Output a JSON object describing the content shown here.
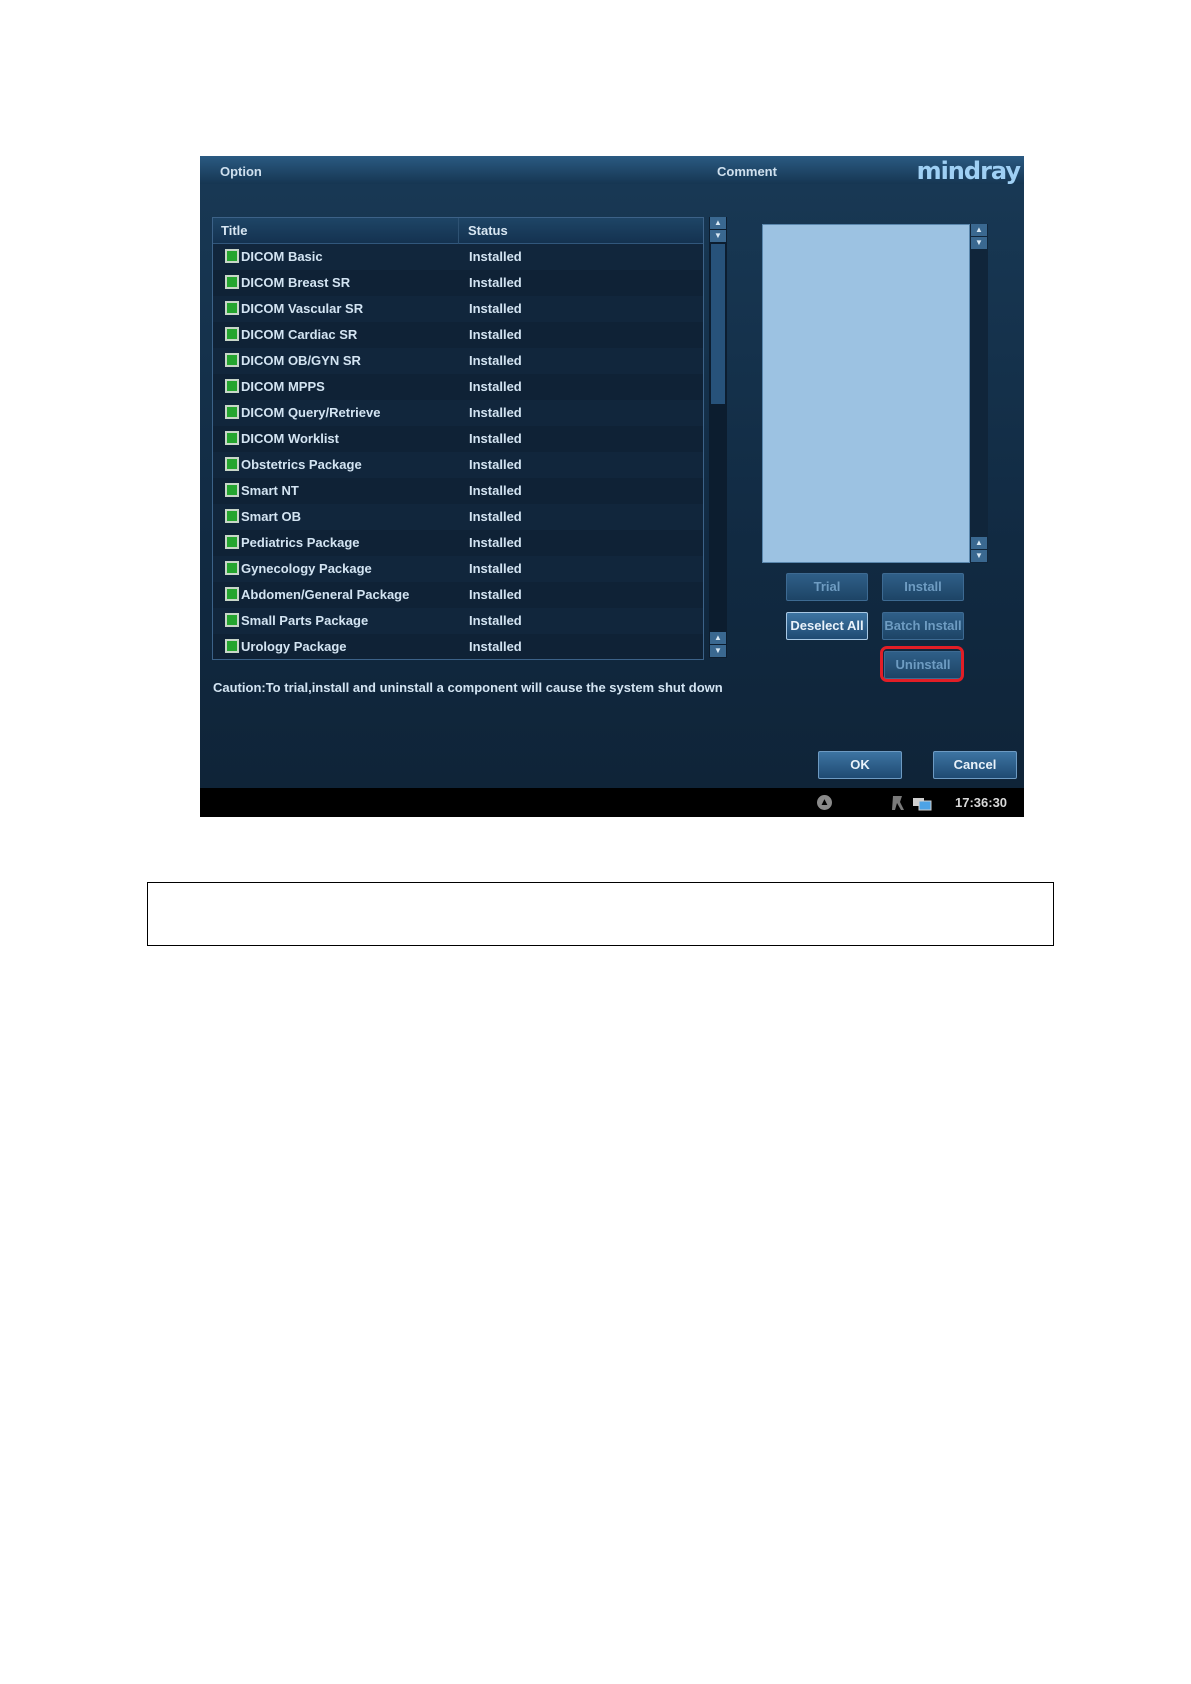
{
  "dialog": {
    "option_label": "Option",
    "comment_label": "Comment",
    "brand": "mindray"
  },
  "table": {
    "columns": [
      "Title",
      "Status"
    ],
    "rows": [
      {
        "title": "DICOM Basic",
        "status": "Installed"
      },
      {
        "title": "DICOM Breast SR",
        "status": "Installed"
      },
      {
        "title": "DICOM Vascular SR",
        "status": "Installed"
      },
      {
        "title": "DICOM Cardiac SR",
        "status": "Installed"
      },
      {
        "title": "DICOM OB/GYN SR",
        "status": "Installed"
      },
      {
        "title": "DICOM MPPS",
        "status": "Installed"
      },
      {
        "title": "DICOM Query/Retrieve",
        "status": "Installed"
      },
      {
        "title": "DICOM Worklist",
        "status": "Installed"
      },
      {
        "title": "Obstetrics Package",
        "status": "Installed"
      },
      {
        "title": "Smart NT",
        "status": "Installed"
      },
      {
        "title": "Smart OB",
        "status": "Installed"
      },
      {
        "title": "Pediatrics Package",
        "status": "Installed"
      },
      {
        "title": "Gynecology Package",
        "status": "Installed"
      },
      {
        "title": "Abdomen/General Package",
        "status": "Installed"
      },
      {
        "title": "Small Parts Package",
        "status": "Installed"
      },
      {
        "title": "Urology Package",
        "status": "Installed"
      }
    ]
  },
  "comment_text": "",
  "buttons": {
    "trial": "Trial",
    "install": "Install",
    "deselect_all": "Deselect All",
    "batch_install": "Batch Install",
    "uninstall": "Uninstall",
    "ok": "OK",
    "cancel": "Cancel"
  },
  "caution": "Caution:To trial,install and uninstall a component will cause the system shut down",
  "statusbar": {
    "time": "17:36:30",
    "icons": [
      "eject-icon",
      "probe-icon",
      "network-icon"
    ]
  },
  "colors": {
    "checkbox": "#25a52f",
    "highlight": "#e21e26",
    "comment_bg": "#9cc2e2"
  }
}
